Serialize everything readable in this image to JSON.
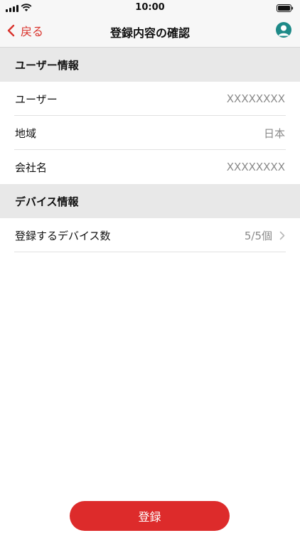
{
  "status": {
    "time": "10:00"
  },
  "nav": {
    "back_label": "戻る",
    "title": "登録内容の確認"
  },
  "user_section": {
    "header": "ユーザー情報",
    "rows": [
      {
        "label": "ユーザー",
        "value": "XXXXXXXX"
      },
      {
        "label": "地域",
        "value": "日本"
      },
      {
        "label": "会社名",
        "value": "XXXXXXXX"
      }
    ]
  },
  "device_section": {
    "header": "デバイス情報",
    "rows": [
      {
        "label": "登録するデバイス数",
        "value": "5/5個"
      }
    ]
  },
  "footer": {
    "register_label": "登録"
  },
  "colors": {
    "accent": "#dd2b2b",
    "account_icon": "#1e8a88",
    "section_bg": "#e8e8e8"
  },
  "icons": [
    "signal-icon",
    "wifi-icon",
    "battery-icon",
    "chevron-left-icon",
    "account-icon",
    "chevron-right-icon"
  ]
}
